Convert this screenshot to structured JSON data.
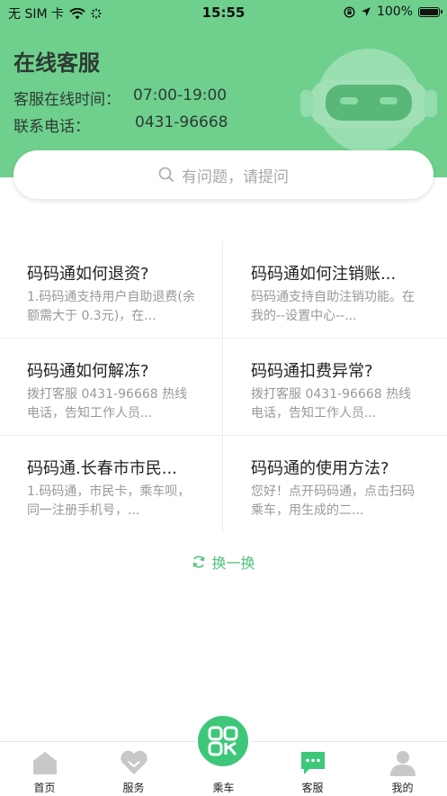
{
  "status_bar": {
    "carrier": "无 SIM 卡",
    "time": "15:55",
    "battery_percent": "100%",
    "battery_level": 1.0
  },
  "header": {
    "title": "在线客服",
    "hours_label": "客服在线时间：",
    "hours_value": "07:00-19:00",
    "phone_label": "联系电话：",
    "phone_value": "0431-96668"
  },
  "search": {
    "placeholder": "有问题，请提问"
  },
  "faq": [
    {
      "title": "码码通如何退资?",
      "desc": "1.码码通支持用户自助退费(余额需大于 0.3元)，在..."
    },
    {
      "title": "码码通如何注销账...",
      "desc": "码码通支持自助注销功能。在我的--设置中心--..."
    },
    {
      "title": "码码通如何解冻?",
      "desc": "拨打客服 0431-96668 热线电话，告知工作人员..."
    },
    {
      "title": "码码通扣费异常?",
      "desc": "拨打客服 0431-96668 热线电话，告知工作人员..."
    },
    {
      "title": "码码通.长春市市民...",
      "desc": "1.码码通，市民卡，乘车呗，同一注册手机号，..."
    },
    {
      "title": "码码通的使用方法?",
      "desc": "您好！点开码码通，点击扫码乘车，用生成的二..."
    }
  ],
  "refresh_label": "换一换",
  "tabbar": {
    "items": [
      {
        "label": "首页",
        "icon": "home-icon"
      },
      {
        "label": "服务",
        "icon": "heart-icon"
      },
      {
        "label": "乘车",
        "icon": "qr-ride-icon"
      },
      {
        "label": "客服",
        "icon": "chat-icon"
      },
      {
        "label": "我的",
        "icon": "person-icon"
      }
    ],
    "active_color": "#3ec77a",
    "inactive_color": "#c8c8c8"
  },
  "colors": {
    "header_green": "#6fd08e",
    "accent_green": "#4fc27a"
  }
}
